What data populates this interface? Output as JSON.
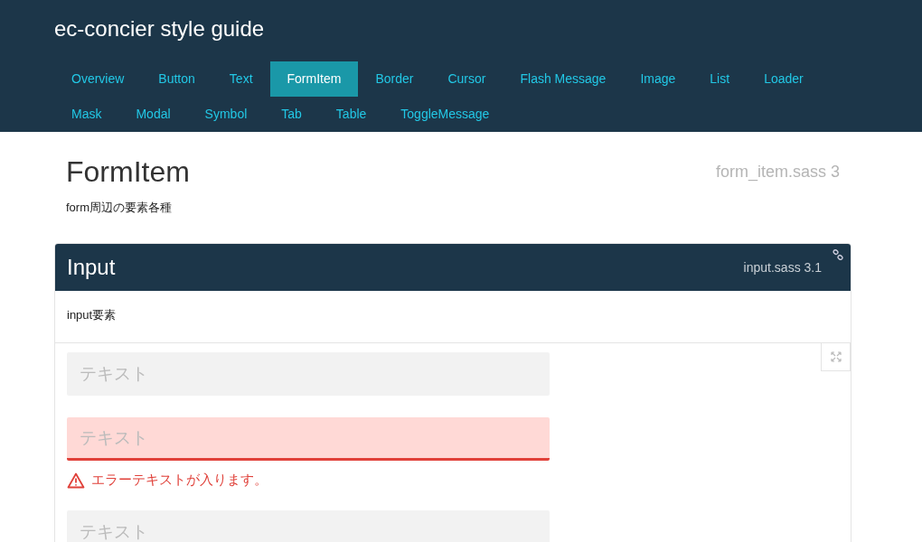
{
  "header": {
    "title": "ec-concier style guide"
  },
  "nav_rows": [
    [
      {
        "label": "Overview",
        "selected": false
      },
      {
        "label": "Button",
        "selected": false
      },
      {
        "label": "Text",
        "selected": false
      },
      {
        "label": "FormItem",
        "selected": true
      },
      {
        "label": "Border",
        "selected": false
      },
      {
        "label": "Cursor",
        "selected": false
      },
      {
        "label": "Flash Message",
        "selected": false
      },
      {
        "label": "Image",
        "selected": false
      },
      {
        "label": "List",
        "selected": false
      },
      {
        "label": "Loader",
        "selected": false
      }
    ],
    [
      {
        "label": "Mask",
        "selected": false
      },
      {
        "label": "Modal",
        "selected": false
      },
      {
        "label": "Symbol",
        "selected": false
      },
      {
        "label": "Tab",
        "selected": false
      },
      {
        "label": "Table",
        "selected": false
      },
      {
        "label": "ToggleMessage",
        "selected": false
      }
    ]
  ],
  "page": {
    "title": "FormItem",
    "source": "form_item.sass 3",
    "description": "form周辺の要素各種"
  },
  "section": {
    "title": "Input",
    "source": "input.sass 3.1",
    "description": "input要素",
    "inputs": [
      {
        "kind": "normal",
        "placeholder": "テキスト"
      },
      {
        "kind": "error",
        "placeholder": "テキスト",
        "error": "エラーテキストが入ります。"
      },
      {
        "kind": "normal",
        "placeholder": "テキスト"
      }
    ]
  }
}
